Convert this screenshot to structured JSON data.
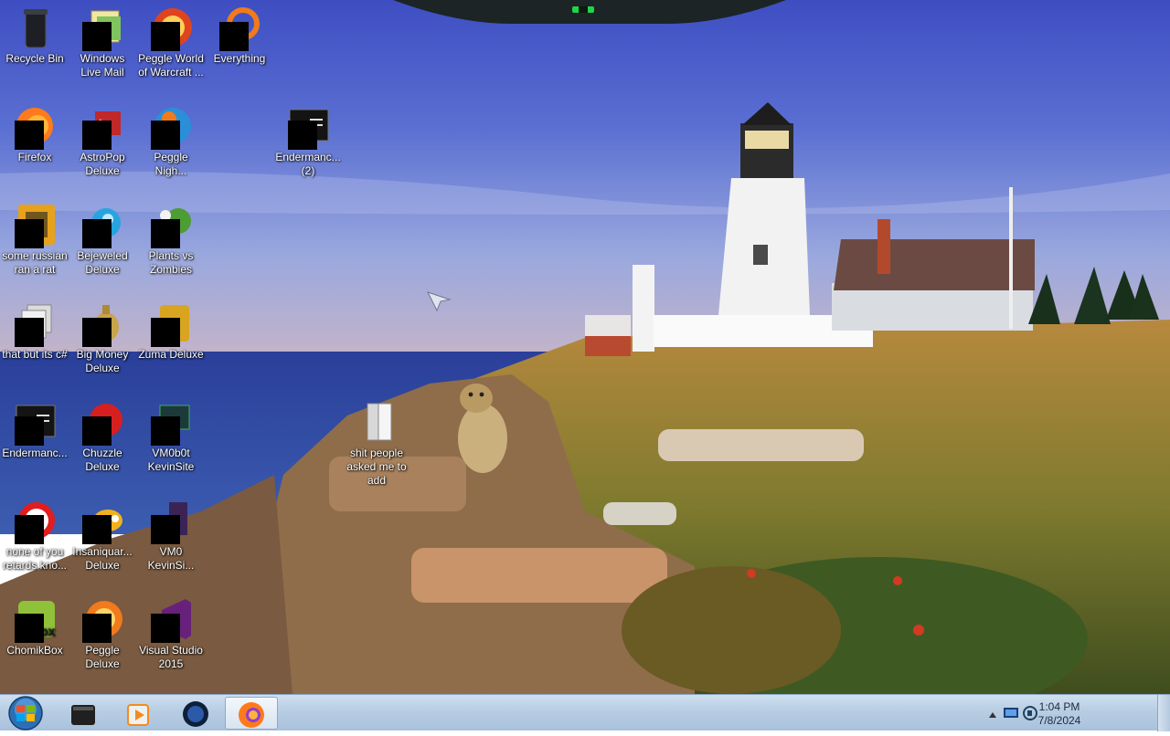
{
  "desktop_icons": [
    {
      "id": "recycle-bin",
      "label": "Recycle Bin",
      "icon": "recycle-bin-icon"
    },
    {
      "id": "windows-live-mail",
      "label": "Windows Live Mail",
      "icon": "mail-icon"
    },
    {
      "id": "peggle-world-of-warcraft",
      "label": "Peggle World of Warcraft ...",
      "icon": "peggle-icon"
    },
    {
      "id": "everything",
      "label": "Everything",
      "icon": "search-icon"
    },
    {
      "id": "firefox",
      "label": "Firefox",
      "icon": "firefox-icon"
    },
    {
      "id": "astropop-deluxe",
      "label": "AstroPop Deluxe",
      "icon": "astropop-icon"
    },
    {
      "id": "peggle-nights",
      "label": "Peggle Nigh...",
      "icon": "peggle-nights-icon"
    },
    {
      "id": "endermanch-2",
      "label": "Endermanc... (2)",
      "icon": "console-app-icon"
    },
    {
      "id": "some-russian-ran-a-rat",
      "label": "some russian ran a rat",
      "icon": "java-app-icon"
    },
    {
      "id": "bejeweled-deluxe",
      "label": "Bejeweled Deluxe",
      "icon": "gem-icon"
    },
    {
      "id": "plants-vs-zombies",
      "label": "Plants vs Zombies",
      "icon": "plant-icon"
    },
    {
      "id": "that-but-its-csharp",
      "label": "that but its c#",
      "icon": "copy-icon"
    },
    {
      "id": "big-money-deluxe",
      "label": "Big Money Deluxe",
      "icon": "money-bag-icon"
    },
    {
      "id": "zuma-deluxe",
      "label": "Zuma Deluxe",
      "icon": "zuma-icon"
    },
    {
      "id": "endermanch",
      "label": "Endermanc...",
      "icon": "console-app-icon"
    },
    {
      "id": "chuzzle-deluxe",
      "label": "Chuzzle Deluxe",
      "icon": "chuzzle-icon"
    },
    {
      "id": "vm0b0t-kevinsite",
      "label": "VM0b0t KevinSite",
      "icon": "app-icon"
    },
    {
      "id": "shit-people-asked",
      "label": "shit people asked me to add",
      "icon": "folder-icon"
    },
    {
      "id": "none-of-you",
      "label": "none of you retards kno...",
      "icon": "app-icon"
    },
    {
      "id": "insaniquarium-deluxe",
      "label": "Insaniquar... Deluxe",
      "icon": "fish-icon"
    },
    {
      "id": "vm0-kevinsite",
      "label": "VM0 KevinSi...",
      "icon": "app-icon"
    },
    {
      "id": "chomikbox",
      "label": "ChomikBox",
      "icon": "chomikbox-icon"
    },
    {
      "id": "peggle-deluxe",
      "label": "Peggle Deluxe",
      "icon": "peggle-icon"
    },
    {
      "id": "visual-studio-2015",
      "label": "Visual Studio 2015",
      "icon": "visual-studio-icon"
    }
  ],
  "taskbar": {
    "start_icon": "windows-start-orb-icon",
    "pinned": [
      {
        "id": "app-black",
        "icon": "app-window-icon"
      },
      {
        "id": "media",
        "icon": "media-player-icon"
      },
      {
        "id": "globe",
        "icon": "globe-icon"
      },
      {
        "id": "firefox",
        "icon": "firefox-icon",
        "active": true
      }
    ],
    "tray": {
      "time": "1:04 PM",
      "date": "7/8/2024"
    }
  }
}
